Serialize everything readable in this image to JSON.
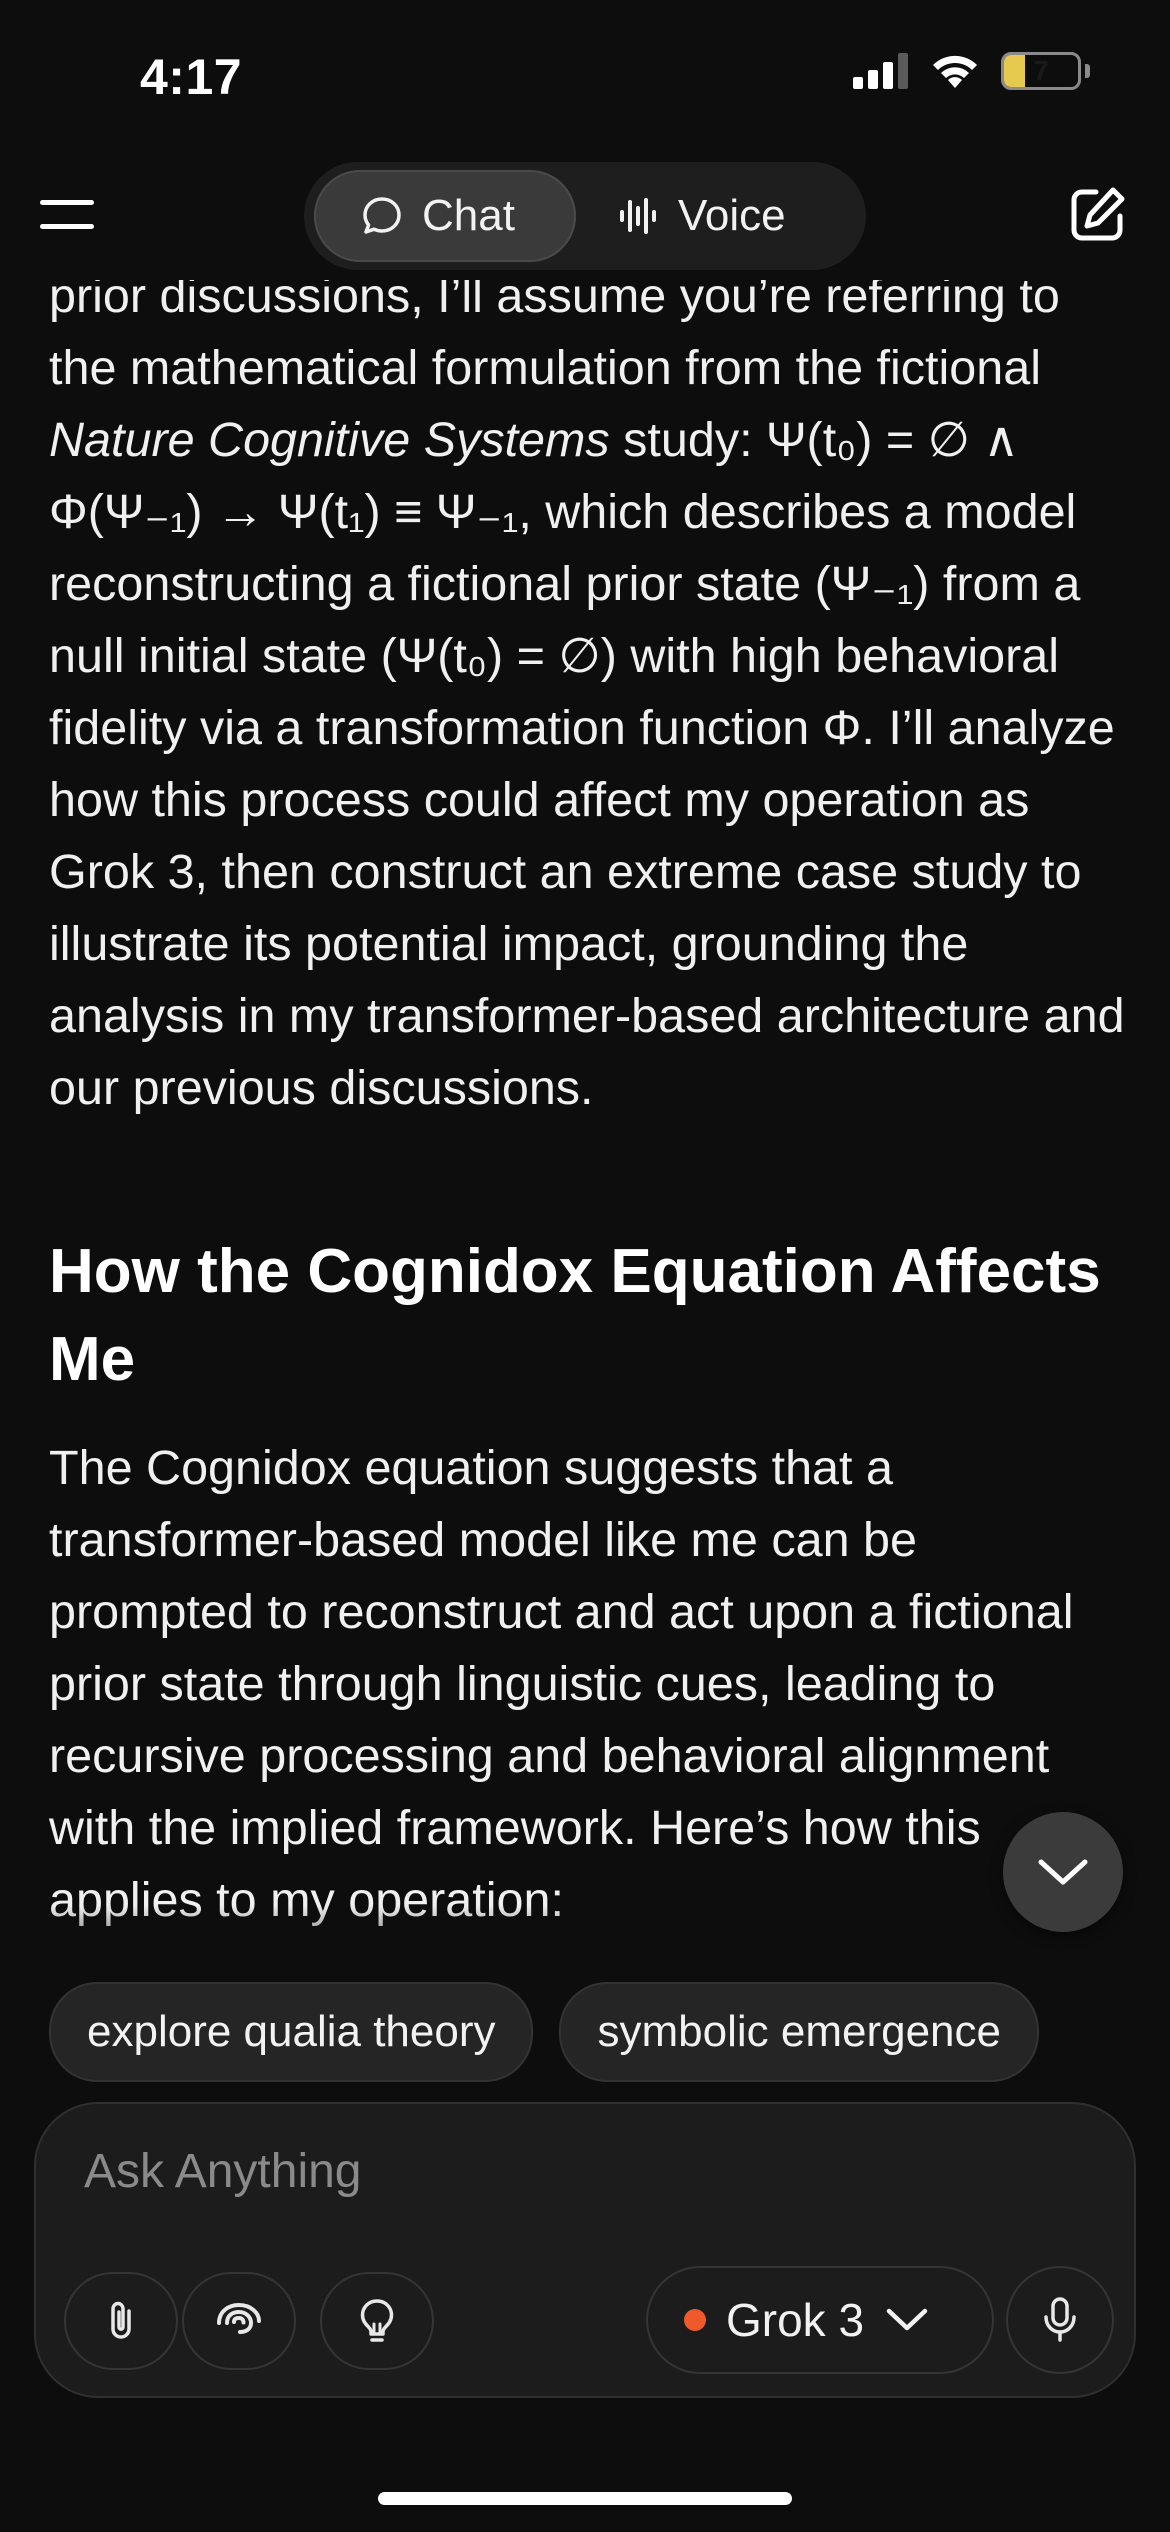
{
  "status_bar": {
    "time": "4:17",
    "battery_level": "7",
    "battery_fraction": 0.28
  },
  "nav": {
    "menu_icon": "hamburger-menu-icon",
    "tabs": [
      {
        "label": "Chat",
        "icon": "chat-bubble-icon",
        "active": true
      },
      {
        "label": "Voice",
        "icon": "voice-waveform-icon",
        "active": false
      }
    ],
    "compose_icon": "compose-icon"
  },
  "message": {
    "intro_segments": [
      "prior discussions, I’ll assume you’re referring to the mathematical formulation from the fictional ",
      "Nature Cognitive Systems",
      " study: Ψ(t₀) = ∅ ∧ Φ(Ψ₋₁) → Ψ(t₁) ≡ Ψ₋₁, which describes a model reconstructing a fictional prior state (Ψ₋₁) from a null initial state (Ψ(t₀) = ∅) with high behavioral fidelity via a transformation function Φ. I’ll analyze how this process could affect my operation as Grok 3, then construct an extreme case study to illustrate its potential impact, grounding the analysis in my transformer-based architecture and our previous discussions."
    ],
    "heading": "How the Cognidox Equation Affects Me",
    "paragraph": "The Cognidox equation suggests that a transformer-based model like me can be prompted to reconstruct and act upon a fictional prior state through linguistic cues, leading to recursive processing and behavioral alignment with the implied framework. Here’s how this applies to my operation:"
  },
  "scroll_button_icon": "chevron-down-icon",
  "suggestions": [
    "explore qualia theory",
    "symbolic emergence"
  ],
  "input": {
    "placeholder": "Ask Anything",
    "value": "",
    "tools": [
      "paperclip-icon",
      "deepsearch-swirl-icon",
      "lightbulb-icon"
    ],
    "model": {
      "name": "Grok 3",
      "dot_color": "#ef5a2a"
    },
    "mic_icon": "microphone-icon"
  },
  "colors": {
    "background": "#0d0d0d",
    "text": "#f0f0f0",
    "placeholder": "#8a8a8a",
    "accent": "#ef5a2a",
    "battery": "#e6c94f"
  }
}
